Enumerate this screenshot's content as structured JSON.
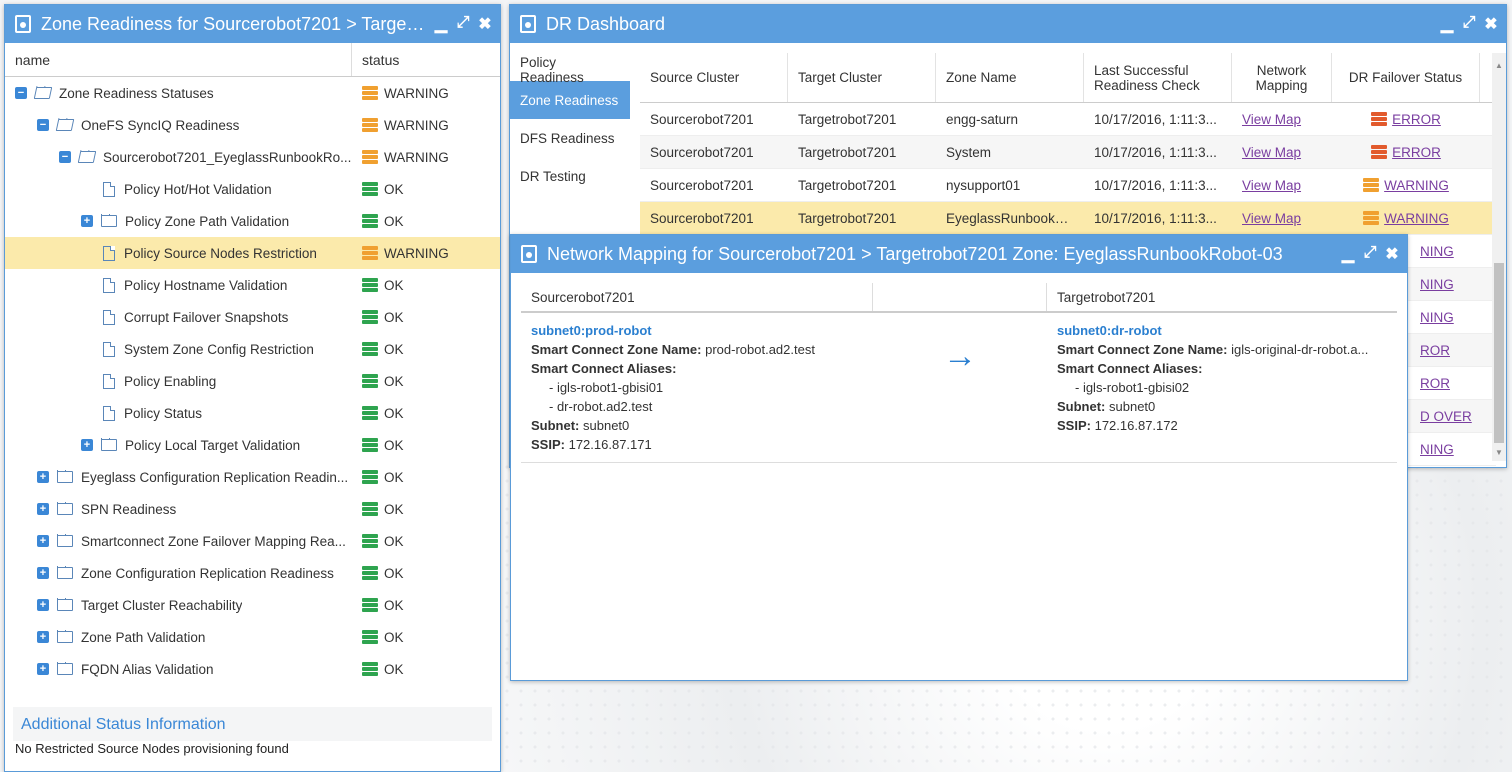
{
  "left_window": {
    "title": "Zone Readiness for Sourcerobot7201 > Targetrob...",
    "col_name": "name",
    "col_status": "status",
    "rows": [
      {
        "label": "Zone Readiness Statuses",
        "status": "WARNING",
        "level": 0,
        "kind": "folder-open",
        "toggle": "−"
      },
      {
        "label": "OneFS SyncIQ Readiness",
        "status": "WARNING",
        "level": 1,
        "kind": "folder-open",
        "toggle": "−"
      },
      {
        "label": "Sourcerobot7201_EyeglassRunbookRo...",
        "status": "WARNING",
        "level": 2,
        "kind": "folder-open",
        "toggle": "−"
      },
      {
        "label": "Policy Hot/Hot Validation",
        "status": "OK",
        "level": 3,
        "kind": "doc",
        "toggle": ""
      },
      {
        "label": "Policy Zone Path Validation",
        "status": "OK",
        "level": 3,
        "kind": "folder",
        "toggle": "+"
      },
      {
        "label": "Policy Source Nodes Restriction",
        "status": "WARNING",
        "level": 3,
        "kind": "doc",
        "toggle": "",
        "selected": true
      },
      {
        "label": "Policy Hostname Validation",
        "status": "OK",
        "level": 3,
        "kind": "doc",
        "toggle": ""
      },
      {
        "label": "Corrupt Failover Snapshots",
        "status": "OK",
        "level": 3,
        "kind": "doc",
        "toggle": ""
      },
      {
        "label": "System Zone Config Restriction",
        "status": "OK",
        "level": 3,
        "kind": "doc",
        "toggle": ""
      },
      {
        "label": "Policy Enabling",
        "status": "OK",
        "level": 3,
        "kind": "doc",
        "toggle": ""
      },
      {
        "label": "Policy Status",
        "status": "OK",
        "level": 3,
        "kind": "doc",
        "toggle": ""
      },
      {
        "label": "Policy Local Target Validation",
        "status": "OK",
        "level": 3,
        "kind": "folder",
        "toggle": "+"
      },
      {
        "label": "Eyeglass Configuration Replication Readin...",
        "status": "OK",
        "level": 1,
        "kind": "folder",
        "toggle": "+"
      },
      {
        "label": "SPN Readiness",
        "status": "OK",
        "level": 1,
        "kind": "folder",
        "toggle": "+"
      },
      {
        "label": "Smartconnect Zone Failover Mapping Rea...",
        "status": "OK",
        "level": 1,
        "kind": "folder",
        "toggle": "+"
      },
      {
        "label": "Zone Configuration Replication Readiness",
        "status": "OK",
        "level": 1,
        "kind": "folder",
        "toggle": "+"
      },
      {
        "label": "Target Cluster Reachability",
        "status": "OK",
        "level": 1,
        "kind": "folder",
        "toggle": "+"
      },
      {
        "label": "Zone Path Validation",
        "status": "OK",
        "level": 1,
        "kind": "folder",
        "toggle": "+"
      },
      {
        "label": "FQDN Alias Validation",
        "status": "OK",
        "level": 1,
        "kind": "folder",
        "toggle": "+"
      }
    ],
    "additional_title": "Additional Status Information",
    "additional_text": "No Restricted Source Nodes provisioning found"
  },
  "dr_window": {
    "title": "DR Dashboard",
    "tabs": [
      "Policy Readiness",
      "Zone Readiness",
      "DFS Readiness",
      "DR Testing"
    ],
    "active_tab": 1,
    "headers": [
      "Source Cluster",
      "Target Cluster",
      "Zone Name",
      "Last Successful Readiness Check",
      "Network Mapping",
      "DR Failover Status"
    ],
    "rows": [
      {
        "source": "Sourcerobot7201",
        "target": "Targetrobot7201",
        "zone": "engg-saturn",
        "last": "10/17/2016, 1:11:3...",
        "map": "View Map",
        "status": "ERROR",
        "kind": "error"
      },
      {
        "source": "Sourcerobot7201",
        "target": "Targetrobot7201",
        "zone": "System",
        "last": "10/17/2016, 1:11:3...",
        "map": "View Map",
        "status": "ERROR",
        "kind": "error"
      },
      {
        "source": "Sourcerobot7201",
        "target": "Targetrobot7201",
        "zone": "nysupport01",
        "last": "10/17/2016, 1:11:3...",
        "map": "View Map",
        "status": "WARNING",
        "kind": "warning"
      },
      {
        "source": "Sourcerobot7201",
        "target": "Targetrobot7201",
        "zone": "EyeglassRunbookR...",
        "last": "10/17/2016, 1:11:3...",
        "map": "View Map",
        "status": "WARNING",
        "kind": "warning"
      }
    ],
    "hidden_status_fragments": [
      "NING",
      "NING",
      "NING",
      "ROR",
      "ROR",
      "D OVER",
      "NING"
    ]
  },
  "nm_window": {
    "title": "Network Mapping for Sourcerobot7201 > Targetrobot7201 Zone: EyeglassRunbookRobot-03",
    "source_header": "Sourcerobot7201",
    "target_header": "Targetrobot7201",
    "source": {
      "subnet": "subnet0:prod-robot",
      "zone_label": "Smart Connect Zone Name:",
      "zone_value": "prod-robot.ad2.test",
      "aliases_label": "Smart Connect Aliases:",
      "alias1": "- igls-robot1-gbisi01",
      "alias2": "- dr-robot.ad2.test",
      "subnet_label": "Subnet:",
      "subnet_value": "subnet0",
      "ssip_label": "SSIP:",
      "ssip_value": "172.16.87.171"
    },
    "target": {
      "subnet": "subnet0:dr-robot",
      "zone_label": "Smart Connect Zone Name:",
      "zone_value": "igls-original-dr-robot.a...",
      "aliases_label": "Smart Connect Aliases:",
      "alias1": "- igls-robot1-gbisi02",
      "subnet_label": "Subnet:",
      "subnet_value": "subnet0",
      "ssip_label": "SSIP:",
      "ssip_value": "172.16.87.172"
    },
    "arrow": "→"
  },
  "controls": {
    "minimize": "▁",
    "maximize": "⤢",
    "close": "✖"
  }
}
